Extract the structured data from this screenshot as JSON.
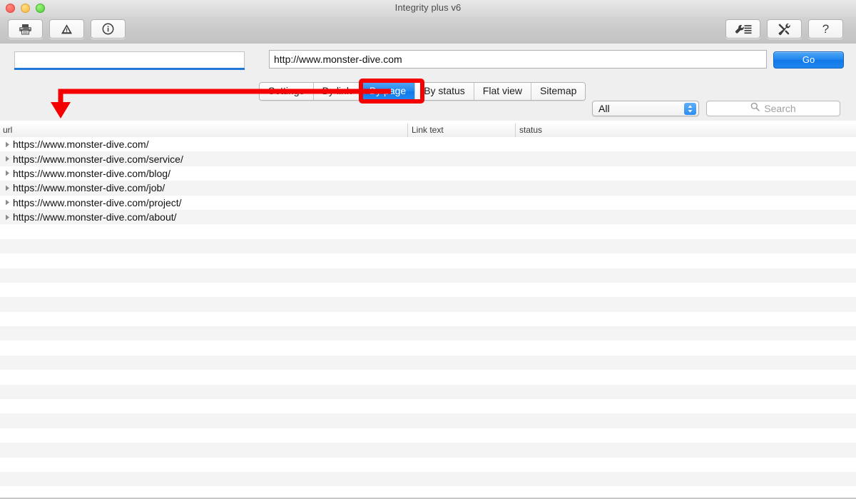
{
  "window": {
    "title": "Integrity plus v6",
    "traffic_lights": [
      "close-red",
      "minimize-yellow",
      "zoom-green"
    ]
  },
  "toolbar": {
    "left_buttons": [
      {
        "name": "print-button",
        "icon": "printer-icon"
      },
      {
        "name": "warnings-button",
        "icon": "warning-triangle-icon"
      },
      {
        "name": "info-button",
        "icon": "info-circle-icon"
      }
    ],
    "right_buttons": [
      {
        "name": "preferences-button",
        "icon": "wrench-lines-icon"
      },
      {
        "name": "tools-button",
        "icon": "crossed-tools-icon"
      },
      {
        "name": "help-button",
        "icon": "question-mark-icon",
        "label": "?"
      }
    ]
  },
  "address": {
    "progress_value": "",
    "progress_placeholder": "",
    "url_value": "http://www.monster-dive.com",
    "url_placeholder": "",
    "go_label": "Go"
  },
  "tabs": [
    {
      "label": "Settings",
      "active": false
    },
    {
      "label": "By link",
      "active": false
    },
    {
      "label": "By page",
      "active": true
    },
    {
      "label": "By status",
      "active": false
    },
    {
      "label": "Flat view",
      "active": false
    },
    {
      "label": "Sitemap",
      "active": false
    }
  ],
  "filter": {
    "selected": "All",
    "options": [
      "All"
    ]
  },
  "search": {
    "value": "",
    "placeholder": "Search",
    "icon": "search-icon"
  },
  "list": {
    "columns": [
      "url",
      "Link text",
      "status"
    ],
    "rows": [
      {
        "url": "https://www.monster-dive.com/",
        "link_text": "",
        "status": ""
      },
      {
        "url": "https://www.monster-dive.com/service/",
        "link_text": "",
        "status": ""
      },
      {
        "url": "https://www.monster-dive.com/blog/",
        "link_text": "",
        "status": ""
      },
      {
        "url": "https://www.monster-dive.com/job/",
        "link_text": "",
        "status": ""
      },
      {
        "url": "https://www.monster-dive.com/project/",
        "link_text": "",
        "status": ""
      },
      {
        "url": "https://www.monster-dive.com/about/",
        "link_text": "",
        "status": ""
      }
    ],
    "empty_row_count": 19
  },
  "annotation": {
    "color": "#f50000",
    "target_tab": "By page",
    "shape": "rounded-rect-with-arrow"
  },
  "colors": {
    "accent_blue": "#1f86ef",
    "annotation_red": "#f50000",
    "row_stripe": "#f4f4f4",
    "toolbar_gray": "#c9c9c9"
  }
}
